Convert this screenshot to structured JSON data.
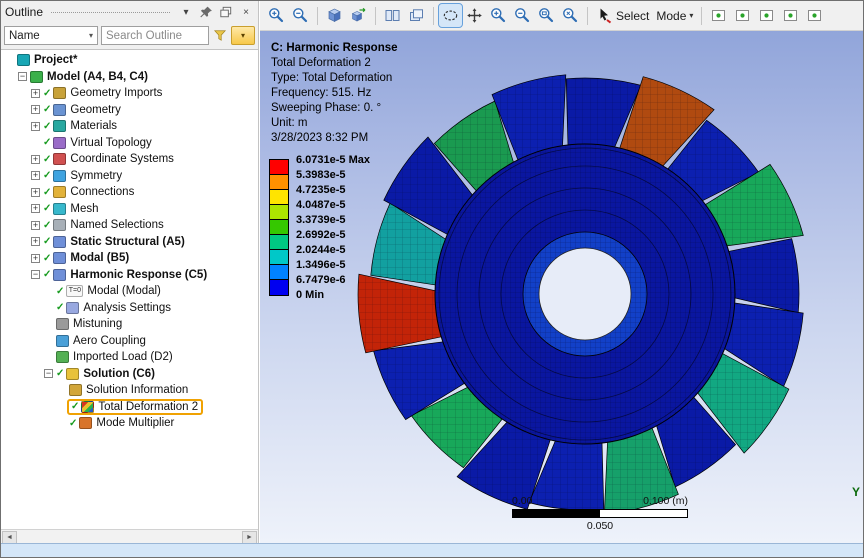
{
  "icons": {
    "chevron": "▾",
    "close": "×",
    "plus": "+",
    "minus": "−",
    "check": "✓",
    "left_arrow": "◄",
    "right_arrow": "►"
  },
  "outline_panel": {
    "title": "Outline",
    "name_filter": {
      "value": "Name"
    },
    "search": {
      "placeholder": "Search Outline"
    },
    "tree": {
      "items": [
        {
          "label": "Project*",
          "level": 0,
          "icon": "project",
          "bold": true,
          "exp": null,
          "check": false
        },
        {
          "label": "Model (A4, B4, C4)",
          "level": 1,
          "icon": "model",
          "bold": true,
          "exp": "minus",
          "check": false
        },
        {
          "label": "Geometry Imports",
          "level": 2,
          "icon": "geometry-imports",
          "bold": false,
          "exp": "plus",
          "check": true
        },
        {
          "label": "Geometry",
          "level": 2,
          "icon": "geometry",
          "bold": false,
          "exp": "plus",
          "check": true
        },
        {
          "label": "Materials",
          "level": 2,
          "icon": "materials",
          "bold": false,
          "exp": "plus",
          "check": true
        },
        {
          "label": "Virtual Topology",
          "level": 2,
          "icon": "virtual-topology",
          "bold": false,
          "exp": null,
          "check": true
        },
        {
          "label": "Coordinate Systems",
          "level": 2,
          "icon": "coordinate-systems",
          "bold": false,
          "exp": "plus",
          "check": true
        },
        {
          "label": "Symmetry",
          "level": 2,
          "icon": "symmetry",
          "bold": false,
          "exp": "plus",
          "check": true
        },
        {
          "label": "Connections",
          "level": 2,
          "icon": "connections",
          "bold": false,
          "exp": "plus",
          "check": true
        },
        {
          "label": "Mesh",
          "level": 2,
          "icon": "mesh",
          "bold": false,
          "exp": "plus",
          "check": true
        },
        {
          "label": "Named Selections",
          "level": 2,
          "icon": "named-selections",
          "bold": false,
          "exp": "plus",
          "check": true
        },
        {
          "label": "Static Structural (A5)",
          "level": 2,
          "icon": "static-structural",
          "bold": true,
          "exp": "plus",
          "check": true
        },
        {
          "label": "Modal (B5)",
          "level": 2,
          "icon": "modal",
          "bold": true,
          "exp": "plus",
          "check": true
        },
        {
          "label": "Harmonic Response (C5)",
          "level": 2,
          "icon": "harmonic-response",
          "bold": true,
          "exp": "minus",
          "check": true
        },
        {
          "label": "Modal (Modal)",
          "level": 3,
          "icon": "modal-t0",
          "bold": false,
          "exp": null,
          "check": true
        },
        {
          "label": "Analysis Settings",
          "level": 3,
          "icon": "analysis-settings",
          "bold": false,
          "exp": null,
          "check": true
        },
        {
          "label": "Mistuning",
          "level": 3,
          "icon": "mistuning",
          "bold": false,
          "exp": null,
          "check": false
        },
        {
          "label": "Aero Coupling",
          "level": 3,
          "icon": "aero-coupling",
          "bold": false,
          "exp": null,
          "check": false
        },
        {
          "label": "Imported Load (D2)",
          "level": 3,
          "icon": "imported-load",
          "bold": false,
          "exp": null,
          "check": false
        },
        {
          "label": "Solution (C6)",
          "level": 3,
          "icon": "solution",
          "bold": true,
          "exp": "minus",
          "check": true
        },
        {
          "label": "Solution Information",
          "level": 4,
          "icon": "solution-information",
          "bold": false,
          "exp": null,
          "check": false
        },
        {
          "label": "Total Deformation 2",
          "level": 4,
          "icon": "result-chart",
          "bold": false,
          "exp": null,
          "check": true,
          "hl": true
        },
        {
          "label": "Mode Multiplier",
          "level": 4,
          "icon": "mode-multiplier",
          "bold": false,
          "exp": null,
          "check": true
        }
      ]
    }
  },
  "toolbar": {
    "groups": [
      {
        "items": [
          {
            "name": "zoom-in-button",
            "icon": "magnifier-plus"
          },
          {
            "name": "zoom-out-button",
            "icon": "magnifier-minus"
          }
        ]
      },
      {
        "items": [
          {
            "name": "isometric-view-button",
            "icon": "cube"
          },
          {
            "name": "manage-views-button",
            "icon": "cube-arrow"
          }
        ]
      },
      {
        "items": [
          {
            "name": "tile-windows-button",
            "icon": "window-tile"
          },
          {
            "name": "cascade-windows-button",
            "icon": "window-cascade"
          }
        ]
      },
      {
        "items": [
          {
            "name": "ellipse-select-button",
            "icon": "ellipse-select",
            "active": true
          },
          {
            "name": "pan-button",
            "icon": "pan-arrows"
          },
          {
            "name": "zoom-in-tool-button",
            "icon": "magnifier-plus"
          },
          {
            "name": "zoom-out-tool-button",
            "icon": "magnifier-minus"
          },
          {
            "name": "box-zoom-button",
            "icon": "magnifier-box"
          },
          {
            "name": "zoom-to-fit-button",
            "icon": "magnifier-fit"
          }
        ]
      },
      {
        "items": [
          {
            "name": "select-mode-dropdown",
            "icon": "select-cursor",
            "label": "Select"
          },
          {
            "name": "mode-dropdown",
            "label": "Mode",
            "chevron": true
          }
        ]
      },
      {
        "items": [
          {
            "name": "select-vertices-filter-button",
            "icon": "filter-box"
          },
          {
            "name": "select-edges-filter-button",
            "icon": "filter-box"
          },
          {
            "name": "select-faces-filter-button",
            "icon": "filter-box"
          },
          {
            "name": "select-bodies-filter-button",
            "icon": "filter-box"
          },
          {
            "name": "extend-selection-button",
            "icon": "filter-box"
          }
        ]
      }
    ]
  },
  "viewport": {
    "annotation": {
      "title": "C: Harmonic Response",
      "lines": [
        "Total Deformation 2",
        "Type: Total Deformation",
        "Frequency: 515. Hz",
        "Sweeping Phase: 0. °",
        "Unit: m",
        "3/28/2023 8:32 PM"
      ]
    },
    "legend": {
      "colors": [
        "#ff0000",
        "#ff9100",
        "#ffe400",
        "#ace400",
        "#35c800",
        "#00c882",
        "#00c8c8",
        "#0082ff",
        "#0000f0"
      ],
      "labels": [
        "6.0731e-5 Max",
        "5.3983e-5",
        "4.7235e-5",
        "4.0487e-5",
        "3.3739e-5",
        "2.6992e-5",
        "2.0244e-5",
        "1.3496e-5",
        "6.7479e-6",
        "0 Min"
      ]
    },
    "ruler": {
      "left_label": "0.00",
      "mid_label": "0.050",
      "right_label": "0.100 (m)"
    },
    "triad": {
      "axis": "Y"
    },
    "wheel": {
      "disk_color": "#0a16a0",
      "hub_ring_color": "#1240c8",
      "hole_color": "#e7ecf8",
      "blade_colors": [
        "#0a1aa6",
        "#b04a10",
        "#0c20b0",
        "#18a85a",
        "#0a1aa6",
        "#0c20b0",
        "#12a882",
        "#0a1aa6",
        "#16a06a",
        "#0c20b0",
        "#0a1aa6",
        "#18a85a",
        "#0c20b0",
        "#c32408",
        "#12a0a0",
        "#0a1aa6",
        "#1a9a50",
        "#0c20b0"
      ],
      "blade_radii": [
        216,
        225,
        212,
        226,
        214,
        219,
        225,
        213,
        221,
        216,
        223,
        212,
        219,
        227,
        215,
        222,
        213,
        220
      ]
    }
  },
  "colors": {
    "tree_highlight": "#f0a202",
    "toolbar_active_bg": "#d4e6f8",
    "status_bar_bg": "#d4e6f8"
  }
}
